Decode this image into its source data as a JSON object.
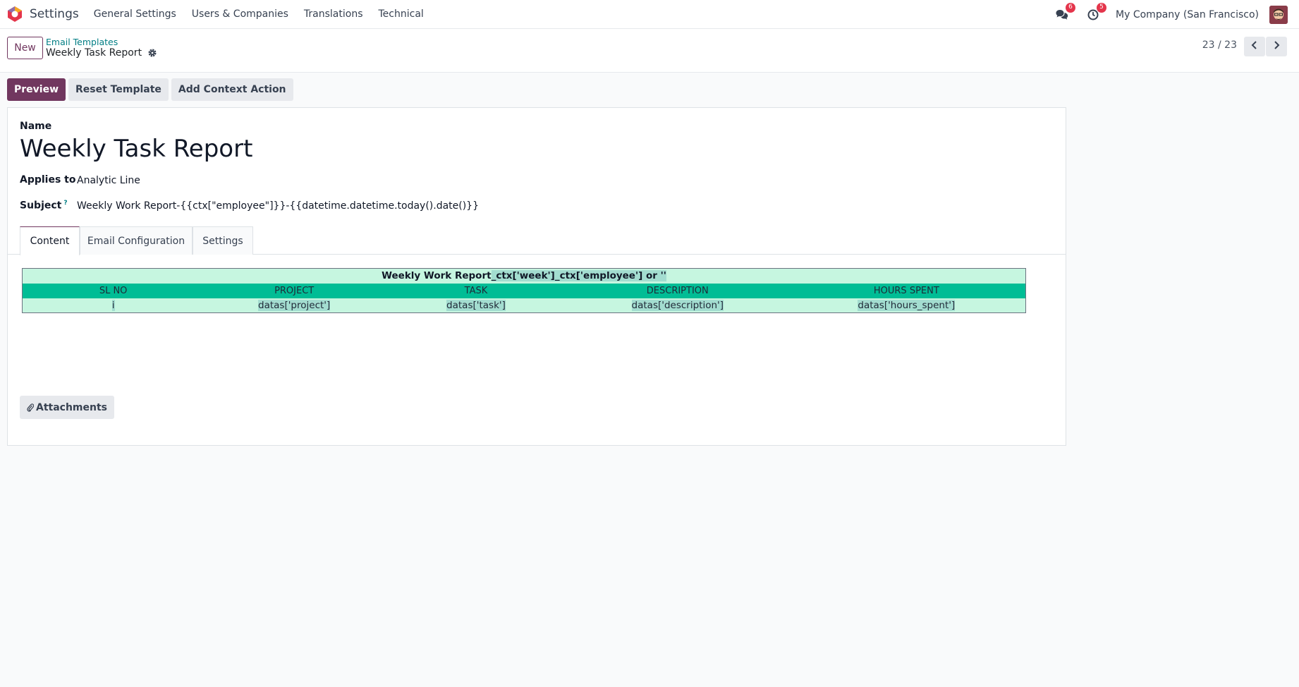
{
  "navbar": {
    "app_name": "Settings",
    "menu": [
      "General Settings",
      "Users & Companies",
      "Translations",
      "Technical"
    ],
    "messages_badge": "6",
    "activities_badge": "5",
    "company": "My Company (San Francisco)"
  },
  "control_panel": {
    "new_label": "New",
    "breadcrumb_parent": "Email Templates",
    "breadcrumb_current": "Weekly Task Report",
    "pager": "23 / 23"
  },
  "actions": {
    "preview": "Preview",
    "reset": "Reset Template",
    "context": "Add Context Action"
  },
  "form": {
    "name_label": "Name",
    "name_value": "Weekly Task Report",
    "applies_label": "Applies to",
    "applies_value": "Analytic Line",
    "subject_label": "Subject",
    "subject_help": "?",
    "subject_value": "Weekly Work Report-{{ctx[\"employee\"]}}-{{datetime.datetime.today().date()}}"
  },
  "tabs": [
    "Content",
    "Email Configuration",
    "Settings"
  ],
  "report": {
    "title_prefix": "Weekly Work Report",
    "title_expr": "_ctx['week']_ctx['employee'] or ''",
    "headers": [
      "SL NO",
      "PROJECT",
      "TASK",
      "DESCRIPTION",
      "HOURS SPENT"
    ],
    "row": [
      "i",
      "datas['project']",
      "datas['task']",
      "datas['description']",
      "datas['hours_spent']"
    ]
  },
  "attachments_label": "Attachments",
  "colors": {
    "primary": "#71375f",
    "link": "#017e84",
    "badge": "#e4354b",
    "table_header": "#00bd95",
    "table_body": "#c6f6e0"
  }
}
